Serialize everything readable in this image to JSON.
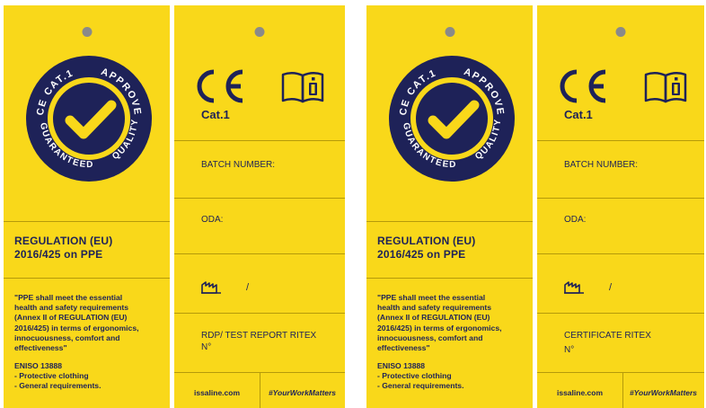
{
  "seal": {
    "ring_top_left": "CE CAT.1",
    "ring_top_right": "APPROVED",
    "ring_right": "QUALITY",
    "ring_bottom": "GUARANTEED"
  },
  "tags": [
    {
      "front": {
        "regulation_title": [
          "REGULATION (EU)",
          "2016/425 on PPE"
        ],
        "quote": [
          "\"PPE shall meet the essential",
          "health and safety requirements",
          "(Annex II of REGULATION  (EU)",
          "2016/425) in terms of ergonomics,",
          "innocuousness, comfort and",
          "effectiveness\""
        ],
        "standard": [
          "ENISO 13888",
          "- Protective clothing",
          "- General requirements."
        ]
      },
      "back": {
        "cat": "Cat.1",
        "batch": "BATCH NUMBER:",
        "oda": "ODA:",
        "slash": "/",
        "report_line1": "RDP/ TEST REPORT RITEX",
        "report_line2": "N°",
        "footer_left": "issaline.com",
        "footer_right": "#YourWorkMatters"
      }
    },
    {
      "front": {
        "regulation_title": [
          "REGULATION (EU)",
          "2016/425 on PPE"
        ],
        "quote": [
          "\"PPE shall meet the essential",
          "health and safety requirements",
          "(Annex II of REGULATION  (EU)",
          "2016/425) in terms of ergonomics,",
          "innocuousness, comfort and",
          "effectiveness\""
        ],
        "standard": [
          "ENISO 13888",
          "- Protective clothing",
          "- General requirements."
        ]
      },
      "back": {
        "cat": "Cat.1",
        "batch": "BATCH NUMBER:",
        "oda": "ODA:",
        "slash": "/",
        "report_line1": "CERTIFICATE RITEX",
        "report_line2": "N°",
        "footer_left": "issaline.com",
        "footer_right": "#YourWorkMatters"
      }
    }
  ],
  "colors": {
    "tag_yellow": "#f9d81a",
    "navy": "#1e2258",
    "hole": "#8a8a8a"
  }
}
